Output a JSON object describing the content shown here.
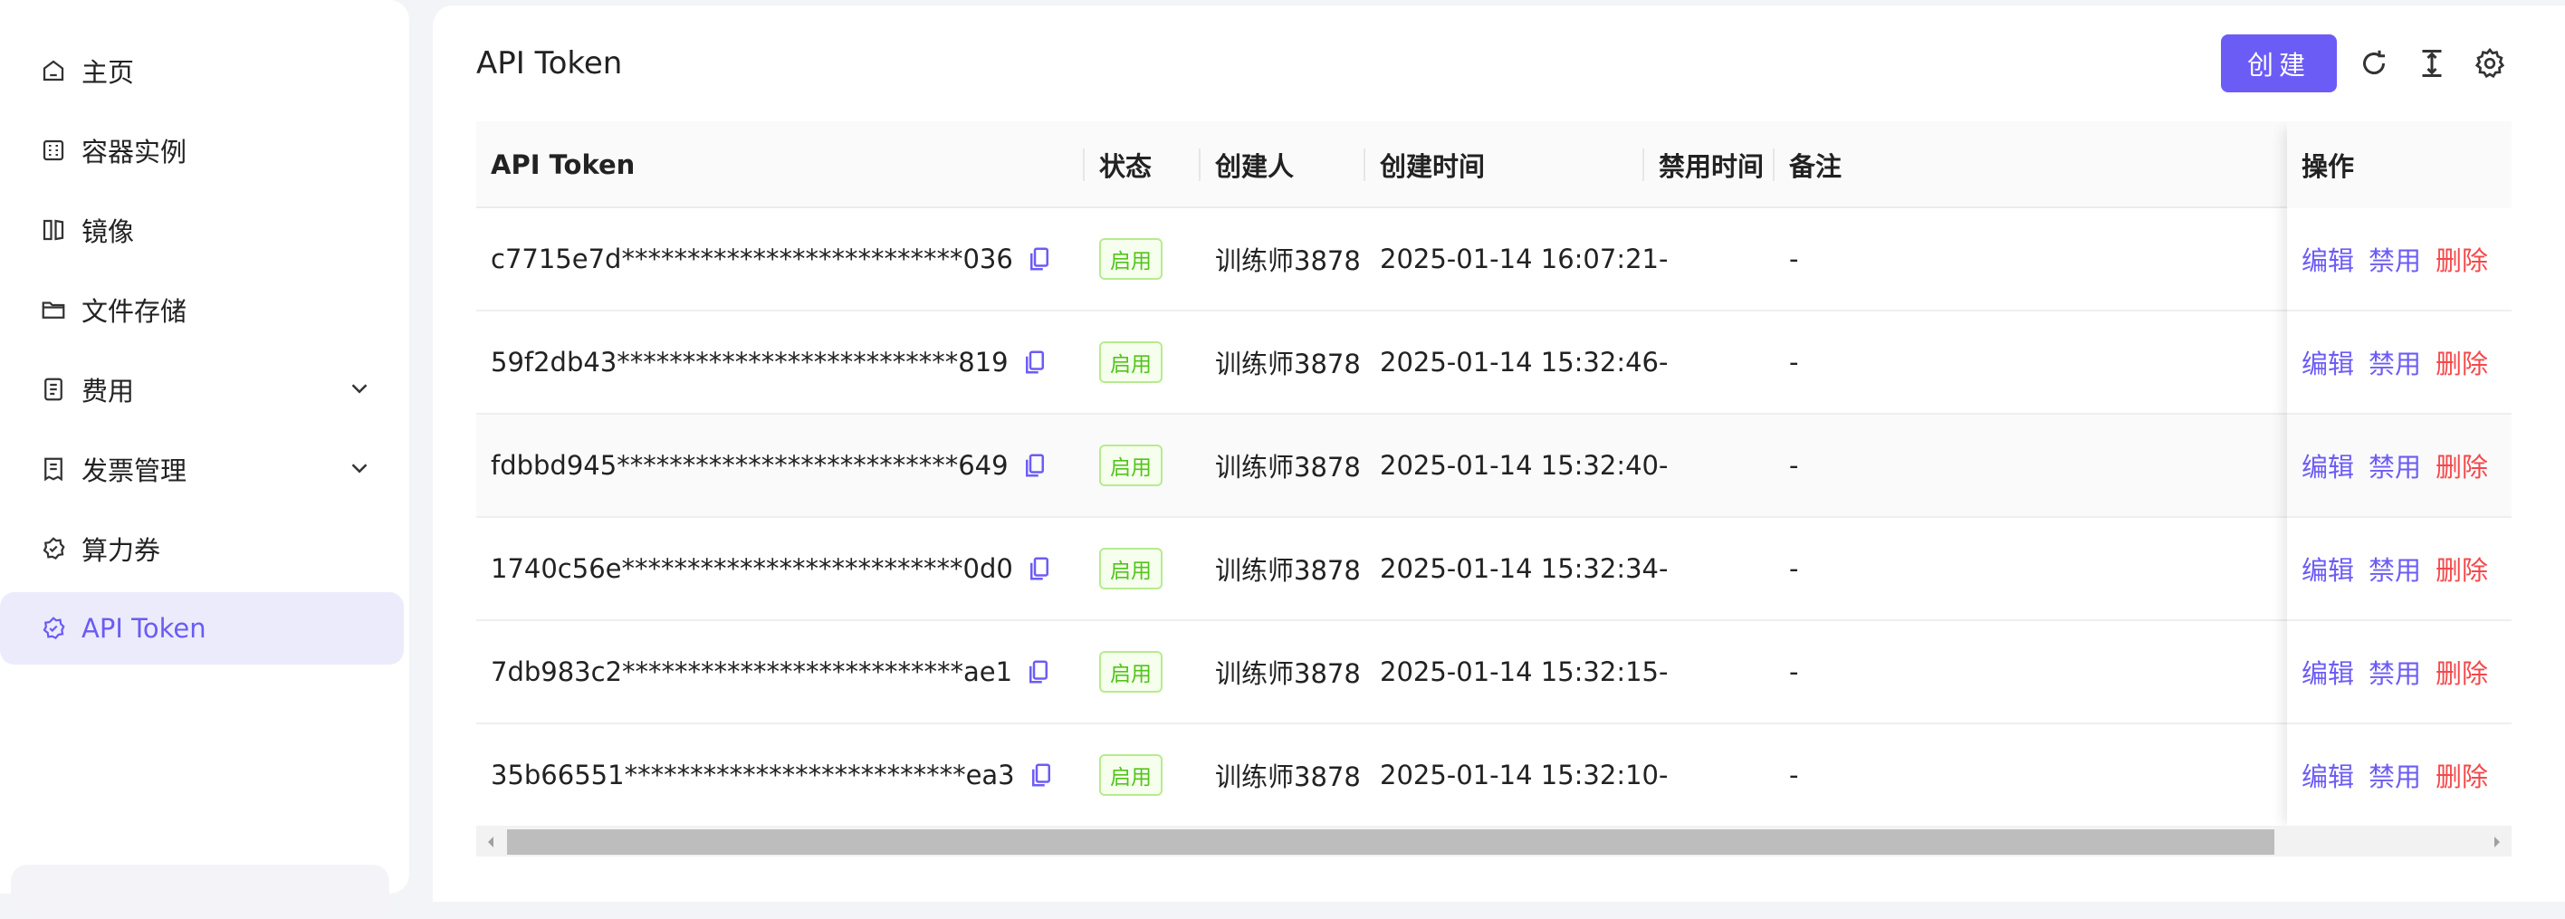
{
  "sidebar": {
    "items": [
      {
        "label": "主页",
        "icon": "home-icon"
      },
      {
        "label": "容器实例",
        "icon": "container-icon"
      },
      {
        "label": "镜像",
        "icon": "image-icon"
      },
      {
        "label": "文件存储",
        "icon": "folder-icon"
      },
      {
        "label": "费用",
        "icon": "bill-icon",
        "expandable": true
      },
      {
        "label": "发票管理",
        "icon": "invoice-icon",
        "expandable": true
      },
      {
        "label": "算力券",
        "icon": "coupon-icon"
      },
      {
        "label": "API Token",
        "icon": "token-icon",
        "active": true
      }
    ]
  },
  "header": {
    "title": "API Token",
    "create_label": "创建",
    "tools": [
      "refresh-icon",
      "column-height-icon",
      "settings-icon"
    ]
  },
  "table": {
    "columns": [
      "API Token",
      "状态",
      "创建人",
      "创建时间",
      "禁用时间",
      "备注",
      "操作"
    ],
    "rows": [
      {
        "token": "c7715e7d**************************036",
        "status": "启用",
        "creator": "训练师3878",
        "created": "2025-01-14 16:07:21",
        "disabled": "-",
        "note": "-"
      },
      {
        "token": "59f2db43**************************819",
        "status": "启用",
        "creator": "训练师3878",
        "created": "2025-01-14 15:32:46",
        "disabled": "-",
        "note": "-"
      },
      {
        "token": "fdbbd945**************************649",
        "status": "启用",
        "creator": "训练师3878",
        "created": "2025-01-14 15:32:40",
        "disabled": "-",
        "note": "-"
      },
      {
        "token": "1740c56e**************************0d0",
        "status": "启用",
        "creator": "训练师3878",
        "created": "2025-01-14 15:32:34",
        "disabled": "-",
        "note": "-"
      },
      {
        "token": "7db983c2**************************ae1",
        "status": "启用",
        "creator": "训练师3878",
        "created": "2025-01-14 15:32:15",
        "disabled": "-",
        "note": "-"
      },
      {
        "token": "35b66551**************************ea3",
        "status": "启用",
        "creator": "训练师3878",
        "created": "2025-01-14 15:32:10",
        "disabled": "-",
        "note": "-"
      }
    ],
    "actions": {
      "edit": "编辑",
      "disable": "禁用",
      "delete": "删除"
    }
  },
  "colors": {
    "accent": "#6c5cf6",
    "danger": "#f5484a",
    "success": "#52c41a",
    "active_bg": "#ecebfb"
  }
}
